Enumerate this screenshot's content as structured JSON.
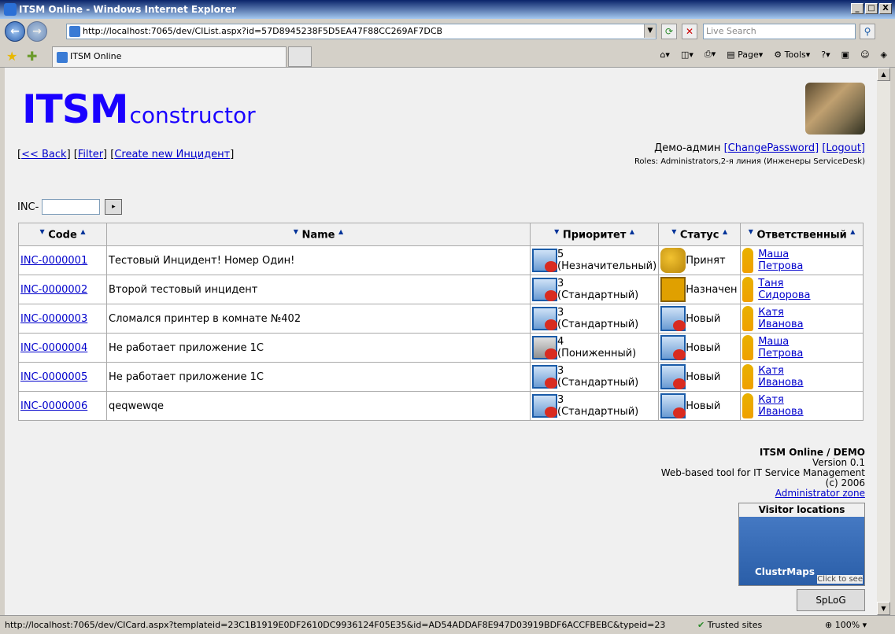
{
  "window": {
    "title": "ITSM Online - Windows Internet Explorer",
    "min": "_",
    "max": "□",
    "close": "X"
  },
  "address": {
    "url": "http://localhost:7065/dev/CIList.aspx?id=57D8945238F5D5EA47F88CC269AF7DCB",
    "search_placeholder": "Live Search"
  },
  "tabs": [
    {
      "label": "ITSM Online"
    }
  ],
  "commandbar": {
    "page": "Page",
    "tools": "Tools"
  },
  "header": {
    "logo_big": "ITSM",
    "logo_small": "constructor",
    "back": "<< Back",
    "filter": "Filter",
    "create": "Create new Инцидент",
    "user": "Демо-админ",
    "change_password": "[ChangePassword]",
    "logout": "[Logout]",
    "roles": "Roles: Administrators,2-я линия (Инженеры ServiceDesk)"
  },
  "filter": {
    "label": "INC-",
    "value": ""
  },
  "table": {
    "headers": [
      "Code",
      "Name",
      "Приоритет",
      "Статус",
      "Ответственный"
    ],
    "rows": [
      {
        "code": "INC-0000001",
        "name": "Тестовый Инцидент! Номер Один!",
        "pri_num": "5",
        "pri_text": "(Незначительный)",
        "status": "Принят",
        "resp_first": "Маша",
        "resp_last": "Петрова"
      },
      {
        "code": "INC-0000002",
        "name": "Второй тестовый инцидент",
        "pri_num": "3",
        "pri_text": "(Стандартный)",
        "status": "Назначен",
        "resp_first": "Таня",
        "resp_last": "Сидорова"
      },
      {
        "code": "INC-0000003",
        "name": "Сломался принтер в комнате №402",
        "pri_num": "3",
        "pri_text": "(Стандартный)",
        "status": "Новый",
        "resp_first": "Катя",
        "resp_last": "Иванова"
      },
      {
        "code": "INC-0000004",
        "name": "Не работает приложение 1С",
        "pri_num": "4",
        "pri_text": "(Пониженный)",
        "status": "Новый",
        "resp_first": "Маша",
        "resp_last": "Петрова"
      },
      {
        "code": "INC-0000005",
        "name": "Не работает приложение 1С",
        "pri_num": "3",
        "pri_text": "(Стандартный)",
        "status": "Новый",
        "resp_first": "Катя",
        "resp_last": "Иванова"
      },
      {
        "code": "INC-0000006",
        "name": "qeqwewqe",
        "pri_num": "3",
        "pri_text": "(Стандартный)",
        "status": "Новый",
        "resp_first": "Катя",
        "resp_last": "Иванова"
      }
    ]
  },
  "footer": {
    "title": "ITSM Online / DEMO",
    "version": "Version 0.1",
    "desc": "Web-based tool for IT Service Management",
    "copy": "(c) 2006",
    "admin": "Administrator zone",
    "map_title": "Visitor locations",
    "map_brand": "ClustrMaps",
    "map_click": "Click to see",
    "splog": "SpLoG"
  },
  "status": {
    "url": "http://localhost:7065/dev/CICard.aspx?templateid=23C1B1919E0DF2610DC9936124F05E35&id=AD54ADDAF8E947D03919BDF6ACCFBEBC&typeid=23",
    "zone": "Trusted sites",
    "zoom": "100%"
  }
}
